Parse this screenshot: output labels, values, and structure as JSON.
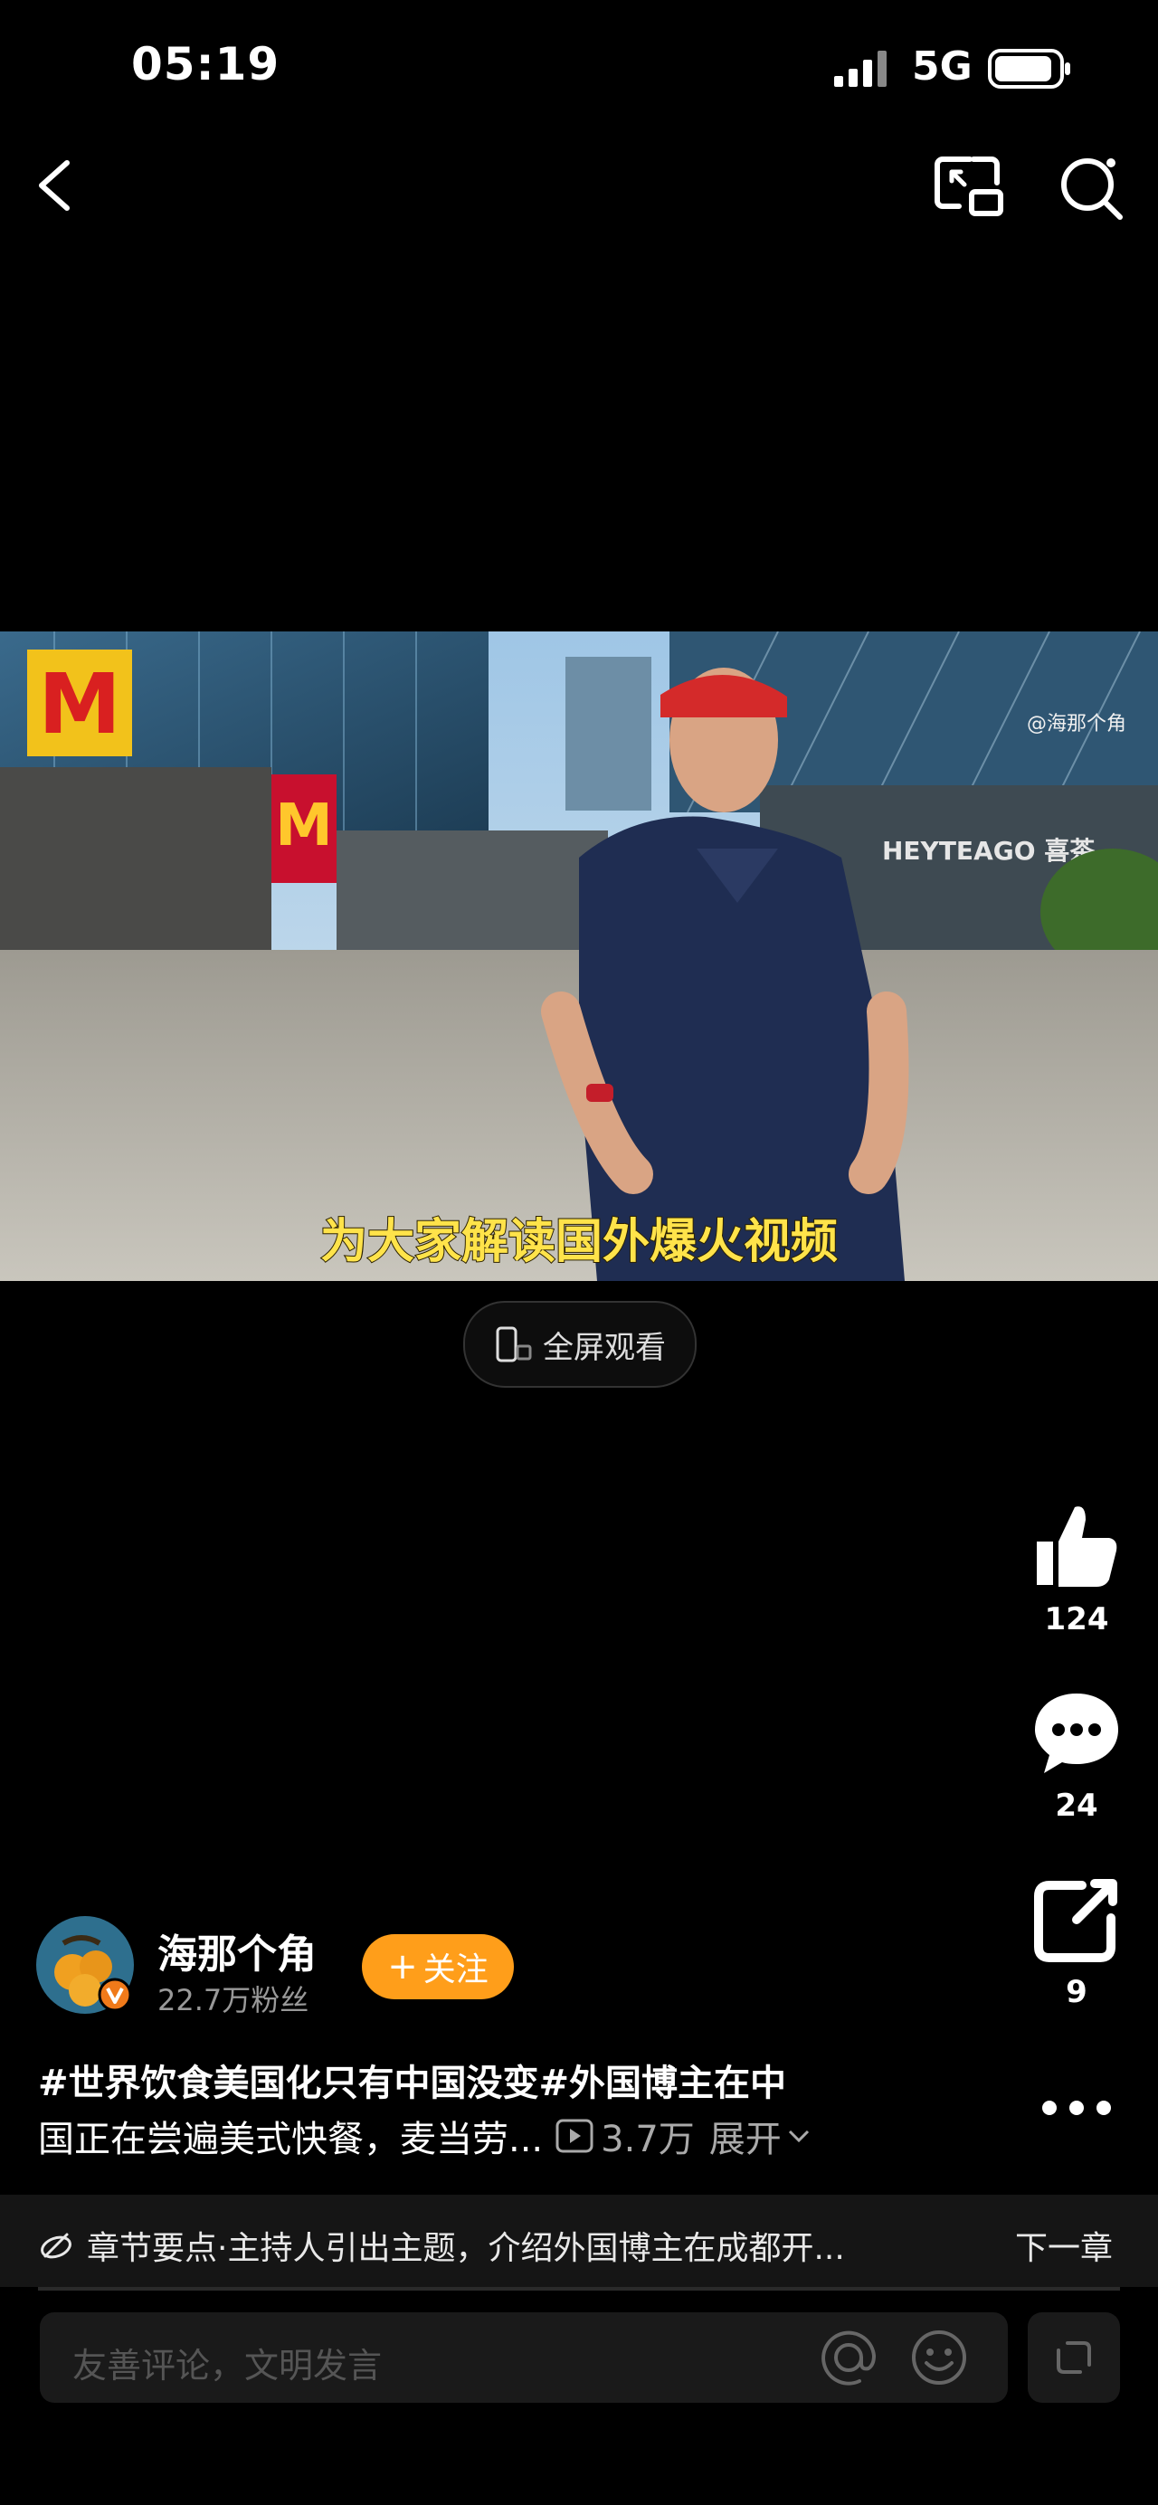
{
  "status_bar": {
    "time": "05:19",
    "network": "5G"
  },
  "video": {
    "subtitle": "为大家解读国外爆火视频",
    "watermark": "@海那个角",
    "fullscreen_label": "全屏观看"
  },
  "actions": {
    "like_count": "124",
    "comment_count": "24",
    "share_count": "9"
  },
  "author": {
    "name": "海那个角",
    "fans": "22.7万粉丝",
    "follow_label": "关注"
  },
  "description": {
    "line1": "#世界饮食美国化只有中国没变#外国博主在中",
    "line2": "国正在尝遍美式快餐，麦当劳...",
    "views": "3.7万",
    "expand": "展开"
  },
  "chapter": {
    "text": "章节要点·主持人引出主题，介绍外国博主在成都开...",
    "next": "下一章"
  },
  "comment_bar": {
    "placeholder": "友善评论，文明发言"
  },
  "colors": {
    "follow": "#ff9e1a",
    "subtitle": "#ffe34a",
    "background": "#000000"
  }
}
